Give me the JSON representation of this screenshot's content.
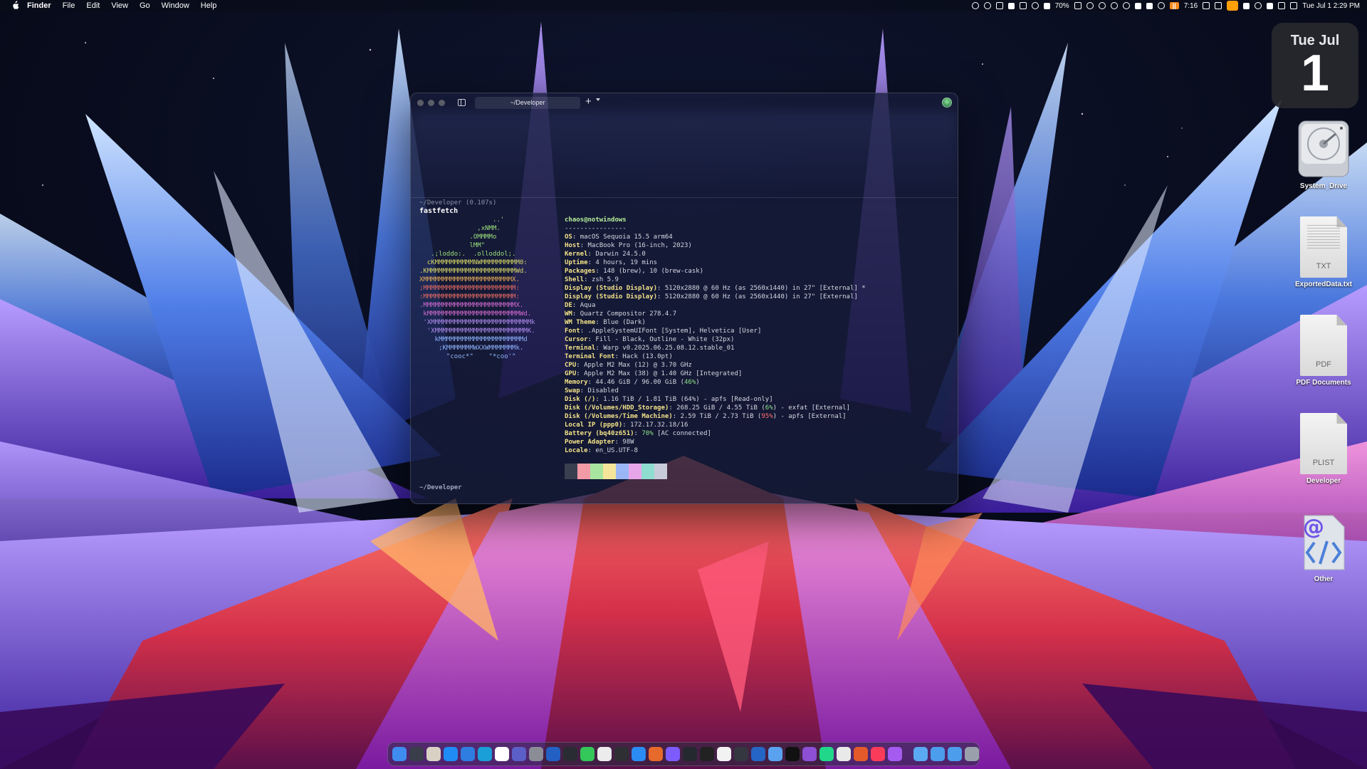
{
  "menubar": {
    "app": "Finder",
    "items": [
      "File",
      "Edit",
      "View",
      "Go",
      "Window",
      "Help"
    ],
    "status": {
      "battery_pct": "70%",
      "timer": "7:16",
      "date_time": "Tue Jul 1  2:29 PM"
    }
  },
  "calendar_widget": {
    "weekday_month": "Tue Jul",
    "day": "1"
  },
  "desktop_items": [
    {
      "label": "System_Drive",
      "icon": "hard-drive-icon"
    },
    {
      "label": "ExportedData.txt",
      "icon": "text-document-icon",
      "ext": "TXT"
    },
    {
      "label": "PDF Documents",
      "icon": "pdf-document-icon",
      "ext": "PDF"
    },
    {
      "label": "Developer",
      "icon": "plist-document-icon",
      "ext": "PLIST"
    },
    {
      "label": "Other",
      "icon": "code-document-icon"
    }
  ],
  "terminal": {
    "tab_title": "~/Developer",
    "command_header": "~/Developer (0.107s)",
    "command": "fastfetch",
    "logo_lines": [
      {
        "text": "                   ..'",
        "color": "#9be07c"
      },
      {
        "text": "               ,xNMM.",
        "color": "#9be07c"
      },
      {
        "text": "             .OMMMMo",
        "color": "#9be07c"
      },
      {
        "text": "             lMM\"",
        "color": "#9be07c"
      },
      {
        "text": "   .;loddo:.  .olloddol;.",
        "color": "#9be07c"
      },
      {
        "text": "  cKMMMMMMMMMMNWMMMMMMMMMM0:",
        "color": "#d8d96a"
      },
      {
        "text": ".KMMMMMMMMMMMMMMMMMMMMMMMWd.",
        "color": "#d8d96a"
      },
      {
        "text": "XMMMMMMMMMMMMMMMMMMMMMMMX.",
        "color": "#e9ad57"
      },
      {
        "text": ";MMMMMMMMMMMMMMMMMMMMMMMM:",
        "color": "#e46a64"
      },
      {
        "text": ":MMMMMMMMMMMMMMMMMMMMMMMM:",
        "color": "#e46a64"
      },
      {
        "text": ".MMMMMMMMMMMMMMMMMMMMMMMMX.",
        "color": "#d46bd0"
      },
      {
        "text": " kMMMMMMMMMMMMMMMMMMMMMMMMWd.",
        "color": "#d46bd0"
      },
      {
        "text": " 'XMMMMMMMMMMMMMMMMMMMMMMMMMMk",
        "color": "#b18bf0"
      },
      {
        "text": "  'XMMMMMMMMMMMMMMMMMMMMMMMMK.",
        "color": "#b18bf0"
      },
      {
        "text": "    kMMMMMMMMMMMMMMMMMMMMMMd",
        "color": "#8fb4ff"
      },
      {
        "text": "     ;KMMMMMMMWXXWMMMMMMMk.",
        "color": "#8fb4ff"
      },
      {
        "text": "       \"cooc*\"    \"*coo'\"",
        "color": "#8fb4ff"
      }
    ],
    "info": {
      "user": "chaos@notwindows",
      "separator": "----------------",
      "rows": [
        {
          "key": "OS",
          "value": "macOS Sequoia 15.5 arm64"
        },
        {
          "key": "Host",
          "value": "MacBook Pro (16-inch, 2023)"
        },
        {
          "key": "Kernel",
          "value": "Darwin 24.5.0"
        },
        {
          "key": "Uptime",
          "value": "4 hours, 19 mins"
        },
        {
          "key": "Packages",
          "value": "148 (brew), 10 (brew-cask)"
        },
        {
          "key": "Shell",
          "value": "zsh 5.9"
        },
        {
          "key": "Display (Studio Display)",
          "value": "5120x2880 @ 60 Hz (as 2560x1440) in 27\" [External] *"
        },
        {
          "key": "Display (Studio Display)",
          "value": "5120x2880 @ 60 Hz (as 2560x1440) in 27\" [External]"
        },
        {
          "key": "DE",
          "value": "Aqua"
        },
        {
          "key": "WM",
          "value": "Quartz Compositor 278.4.7"
        },
        {
          "key": "WM Theme",
          "value": "Blue (Dark)"
        },
        {
          "key": "Font",
          "value": ".AppleSystemUIFont [System], Helvetica [User]"
        },
        {
          "key": "Cursor",
          "value": "Fill - Black, Outline - White (32px)"
        },
        {
          "key": "Terminal",
          "value": "Warp v0.2025.06.25.08.12.stable_01"
        },
        {
          "key": "Terminal Font",
          "value": "Hack (13.0pt)"
        },
        {
          "key": "CPU",
          "value": "Apple M2 Max (12) @ 3.70 GHz"
        },
        {
          "key": "GPU",
          "value": "Apple M2 Max (38) @ 1.40 GHz [Integrated]"
        },
        {
          "key": "Memory",
          "value": "44.46 GiB / 96.00 GiB (",
          "pct": "46%",
          "pct_color": "green",
          "tail": ")"
        },
        {
          "key": "Swap",
          "value": "Disabled"
        },
        {
          "key": "Disk (/)",
          "value": "1.16 TiB / 1.81 TiB (64%) - apfs [Read-only]"
        },
        {
          "key": "Disk (/Volumes/HDD_Storage)",
          "value": "268.25 GiB / 4.55 TiB (",
          "pct": "6%",
          "pct_color": "green",
          "tail": ") - exfat [External]"
        },
        {
          "key": "Disk (/Volumes/Time Machine)",
          "value": "2.59 TiB / 2.73 TiB (",
          "pct": "95%",
          "pct_color": "red",
          "tail": ") - apfs [External]"
        },
        {
          "key": "Local IP (ppp0)",
          "value": "172.17.32.18/16"
        },
        {
          "key": "Battery (bq40z651)",
          "value": "",
          "pct": "70%",
          "pct_color": "green",
          "tail": " [AC connected]"
        },
        {
          "key": "Power Adapter",
          "value": "98W"
        },
        {
          "key": "Locale",
          "value": "en_US.UTF-8"
        }
      ]
    },
    "palette": [
      "#3a3f50",
      "#f29aa6",
      "#a8e6a0",
      "#f5e59a",
      "#9ab6f5",
      "#e7a6ea",
      "#8fdcd0",
      "#c8ccda"
    ],
    "prompt_path": "~/Developer"
  },
  "dock": {
    "apps": [
      {
        "name": "finder-icon",
        "color": "#3f8cf0"
      },
      {
        "name": "mission-control-icon",
        "color": "#3a3e4a"
      },
      {
        "name": "launchpad-icon",
        "color": "#d9d2c4"
      },
      {
        "name": "app-store-icon",
        "color": "#1f8bf5"
      },
      {
        "name": "mail-icon",
        "color": "#2f7de0"
      },
      {
        "name": "edge-browser-icon",
        "color": "#1a9fd8"
      },
      {
        "name": "calendar-icon",
        "color": "#ffffff"
      },
      {
        "name": "teams-icon",
        "color": "#5b5fc7"
      },
      {
        "name": "settings-icon",
        "color": "#8a8d96"
      },
      {
        "name": "quicktime-icon",
        "color": "#2360c4"
      },
      {
        "name": "notes-terminal-icon",
        "color": "#2a2c33"
      },
      {
        "name": "messages-icon",
        "color": "#34c759"
      },
      {
        "name": "craft-icon",
        "color": "#ececec"
      },
      {
        "name": "notion-icon",
        "color": "#2e2f33"
      },
      {
        "name": "safari-icon",
        "color": "#2b8cf4"
      },
      {
        "name": "firefox-icon",
        "color": "#e66a2c"
      },
      {
        "name": "arc-icon",
        "color": "#7c5cff"
      },
      {
        "name": "github-icon",
        "color": "#24292f"
      },
      {
        "name": "docker-icon",
        "color": "#222"
      },
      {
        "name": "chat-icon",
        "color": "#f2f2f2"
      },
      {
        "name": "chatgpt-icon",
        "color": "#353740"
      },
      {
        "name": "remote-desktop-icon",
        "color": "#2565c4"
      },
      {
        "name": "preview-icon",
        "color": "#5aa2f0"
      },
      {
        "name": "jetbrains-icon",
        "color": "#111"
      },
      {
        "name": "visual-studio-icon",
        "color": "#8c4fd6"
      },
      {
        "name": "pycharm-icon",
        "color": "#21d789"
      },
      {
        "name": "chrome-icon",
        "color": "#e9e9e9"
      },
      {
        "name": "office-icon",
        "color": "#e45a2b"
      },
      {
        "name": "music-icon",
        "color": "#fa3c5a"
      },
      {
        "name": "podcast-icon",
        "color": "#a55bf0"
      }
    ],
    "folders": [
      {
        "name": "folder-icon",
        "color": "#5aa9f2"
      },
      {
        "name": "downloads-folder-icon",
        "color": "#4d9ded"
      },
      {
        "name": "documents-folder-icon",
        "color": "#4d9ded"
      },
      {
        "name": "trash-icon",
        "color": "#9aa0ab"
      }
    ]
  }
}
